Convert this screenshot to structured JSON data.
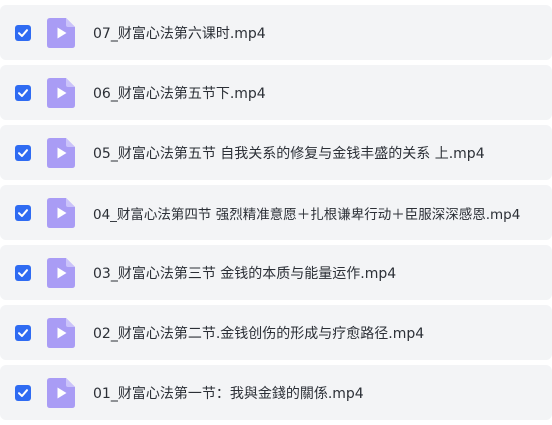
{
  "files": [
    {
      "name": "07_财富心法第六课时.mp4",
      "checked": true
    },
    {
      "name": "06_财富心法第五节下.mp4",
      "checked": true
    },
    {
      "name": "05_财富心法第五节 自我关系的修复与金钱丰盛的关系 上.mp4",
      "checked": true
    },
    {
      "name": "04_财富心法第四节 强烈精准意愿＋扎根谦卑行动＋臣服深深感恩.mp4",
      "checked": true
    },
    {
      "name": "03_财富心法第三节 金钱的本质与能量运作.mp4",
      "checked": true
    },
    {
      "name": "02_财富心法第二节.金钱创伤的形成与疗愈路径.mp4",
      "checked": true
    },
    {
      "name": "01_财富心法第一节：我與金錢的關係.mp4",
      "checked": true
    }
  ],
  "icons": {
    "checkbox": "checkbox-checked-icon",
    "file": "video-file-icon"
  },
  "colors": {
    "checkbox": "#2f6bf2",
    "file_icon": "#a99cf5",
    "file_icon_fold": "#cbc3fa",
    "row_bg": "#f3f4f6",
    "text": "#2b2f36"
  }
}
